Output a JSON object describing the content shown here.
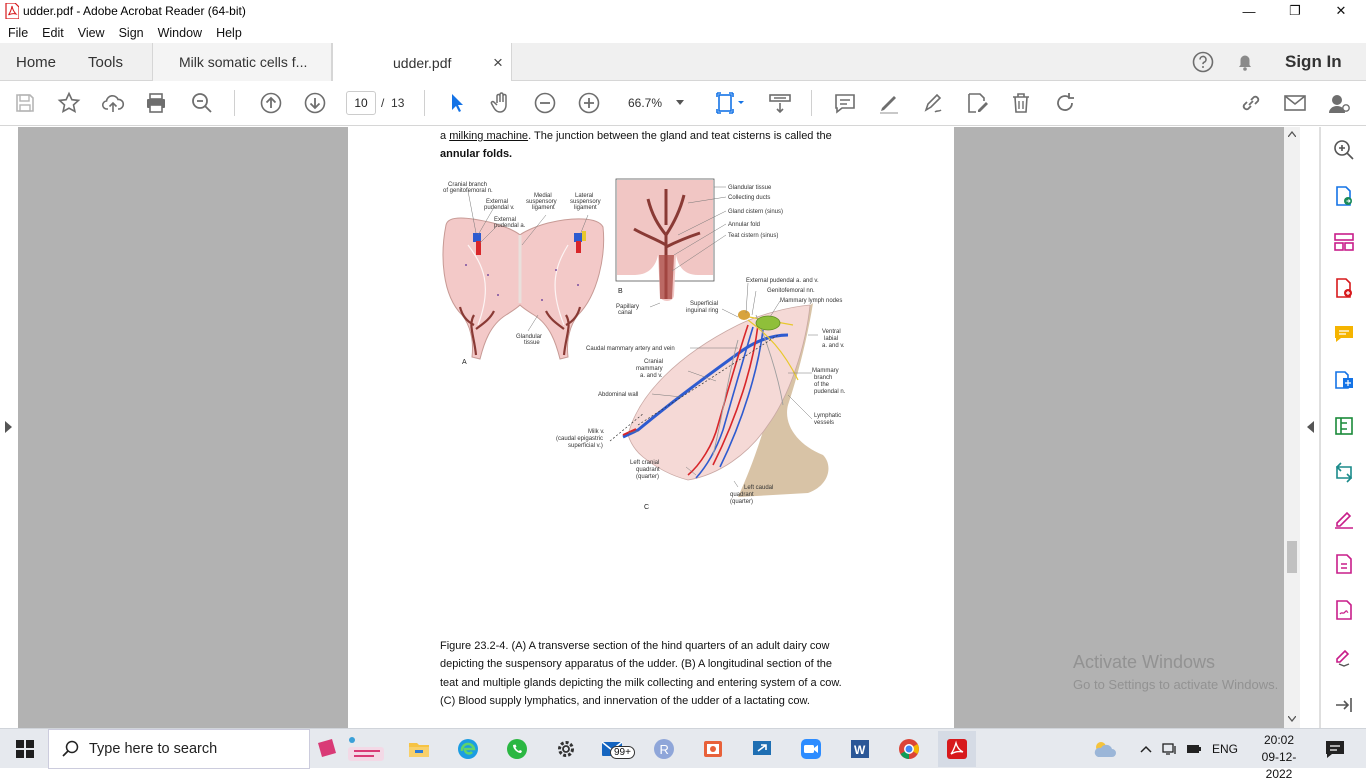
{
  "window": {
    "title": "udder.pdf - Adobe Acrobat Reader (64-bit)",
    "minimize": "—",
    "maximize": "❐",
    "close": "✕"
  },
  "menu": [
    "File",
    "Edit",
    "View",
    "Sign",
    "Window",
    "Help"
  ],
  "tabs": {
    "home": "Home",
    "tools": "Tools",
    "doc1": "Milk somatic cells  f...",
    "doc2": "udder.pdf",
    "close_glyph": "×"
  },
  "header_right": {
    "sign_in": "Sign In"
  },
  "toolbar": {
    "page_current": "10",
    "page_sep": "/",
    "page_total": "13",
    "zoom": "66.7%"
  },
  "document": {
    "line1_prefix": "a ",
    "line1_link": "milking machine",
    "line1_suffix": ". The junction between the gland and teat cisterns is called the",
    "line2": "annular folds.",
    "caption": [
      "Figure 23.2-4. (A) A transverse section of the hind quarters of an adult dairy cow",
      "depicting the suspensory apparatus of the udder. (B) A longitudinal section of the",
      "teat and multiple glands depicting the milk collecting and entering system of a cow.",
      "(C) Blood supply lymphatics, and innervation of the udder of a lactating cow."
    ],
    "figure_labels": {
      "a_cranial": "Cranial branch",
      "a_cranial2": "of genitofemoral n.",
      "a_ext_v": "External",
      "a_ext_v2": "pudendal v.",
      "a_ext_a": "External",
      "a_ext_a2": "pudendal a.",
      "a_medial": "Medial",
      "a_medial2": "suspensory",
      "a_medial3": "ligament",
      "a_lateral": "Lateral",
      "a_lateral2": "suspensory",
      "a_lateral3": "ligament",
      "a_glandular": "Glandular",
      "a_glandular2": "tissue",
      "a_letter": "A",
      "b_glandular": "Glandular tissue",
      "b_collecting": "Collecting ducts",
      "b_cistern": "Gland cistern (sinus)",
      "b_annular": "Annular fold",
      "b_teat": "Teat cistern (sinus)",
      "b_papillary": "Papillary",
      "b_papillary2": "canal",
      "b_letter": "B",
      "c_ext_pud": "External pudendal a. and v.",
      "c_genito": "Genitofemoral nn.",
      "c_lymph": "Mammary lymph nodes",
      "c_superficial": "Superficial",
      "c_superficial2": "inguinal ring",
      "c_ventral": "Ventral",
      "c_ventral2": "labial",
      "c_ventral3": "a. and v.",
      "c_caudal": "Caudal mammary artery and vein",
      "c_cranial": "Cranial",
      "c_cranial2": "mammary",
      "c_cranial3": "a. and v.",
      "c_mammary_branch": "Mammary",
      "c_mammary_branch2": "branch",
      "c_mammary_branch3": "of the",
      "c_mammary_branch4": "pudendal n.",
      "c_abdominal": "Abdominal wall",
      "c_lymphatic": "Lymphatic",
      "c_lymphatic2": "vessels",
      "c_milk": "Milk v.",
      "c_milk2": "(caudal epigastric",
      "c_milk3": "superficial v.)",
      "c_left_cranial": "Left cranial",
      "c_left_cranial2": "quadrant",
      "c_left_cranial3": "(quarter)",
      "c_left_caudal": "Left caudal",
      "c_left_caudal2": "quadrant",
      "c_left_caudal3": "(quarter)",
      "c_letter": "C"
    }
  },
  "watermark": {
    "line1": "Activate Windows",
    "line2": "Go to Settings to activate Windows."
  },
  "taskbar": {
    "search_placeholder": "Type here to search",
    "mail_badge": "99+",
    "lang": "ENG",
    "time": "20:02",
    "date": "09-12-2022"
  },
  "colors": {
    "accent_blue": "#1473e6",
    "icon_gray": "#6e6e6e",
    "pink_tool": "#c81e8a",
    "acrobat_red": "#d7191c"
  }
}
